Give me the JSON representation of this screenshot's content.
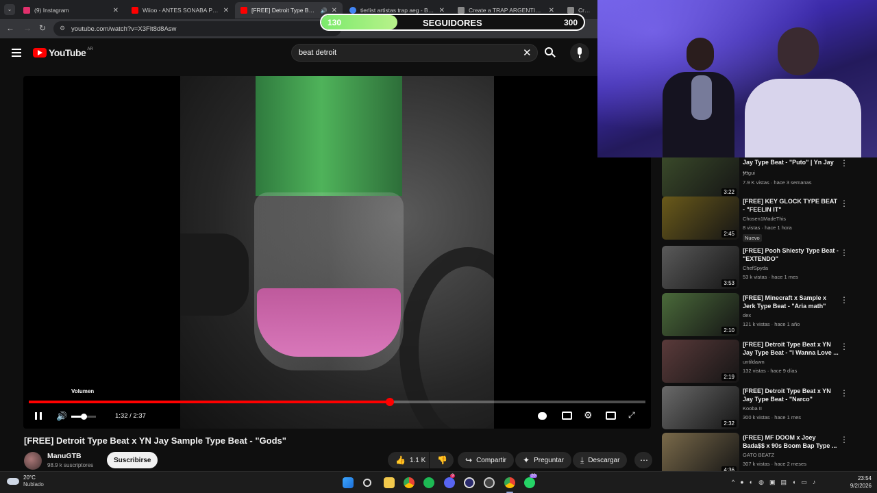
{
  "browser": {
    "tabs": [
      {
        "label": "(9) Instagram",
        "color": "#e1306c"
      },
      {
        "label": "Wiioo - ANTES SONABA PEOR",
        "color": "#ff0000"
      },
      {
        "label": "[FREE] Detroit Type Beat x Y",
        "color": "#ff0000"
      },
      {
        "label": "tierlist artistas trap aeg - Busca",
        "color": "#4285f4"
      },
      {
        "label": "Create a TRAP ARGENTINO Tie",
        "color": "#888888"
      },
      {
        "label": "Create a",
        "color": "#888888"
      }
    ],
    "url": "youtube.com/watch?v=X3Flt8d8Asw"
  },
  "overlay": {
    "min": "130",
    "label": "SEGUIDORES",
    "max": "300",
    "progress": 0.29
  },
  "youtube": {
    "logo": "YouTube",
    "region": "AR",
    "search_value": "beat detroit"
  },
  "player": {
    "tooltip": "Volumen",
    "time": "1:32 / 2:37",
    "progress": 0.586,
    "volume": 0.5
  },
  "video": {
    "title": "[FREE] Detroit Type Beat x YN Jay Sample Type Beat - \"Gods\"",
    "channel": "ManuGTB",
    "subscribers": "98.9 k suscriptores",
    "subscribe_label": "Suscribirse",
    "likes": "1.1 K",
    "share_label": "Compartir",
    "ask_label": "Preguntar",
    "download_label": "Descargar"
  },
  "sidebar": {
    "items": [
      {
        "title": "Jay Type Beat - \"Puto\" | Yn Jay ...",
        "channel": "yugui",
        "meta": "7.9 K vistas · hace 3 semanas",
        "duration": "3:22",
        "badge": ""
      },
      {
        "title": "[FREE] KEY GLOCK TYPE BEAT - \"FEELIN IT\"",
        "channel": "Chosen1MadeThis",
        "meta": "8 vistas · hace 1 hora",
        "duration": "2:45",
        "badge": "Nuevo"
      },
      {
        "title": "[FREE] Pooh Shiesty Type Beat - \"EXTENDO\"",
        "channel": "ChefSpyda",
        "meta": "53 k vistas · hace 1 mes",
        "duration": "3:53",
        "badge": ""
      },
      {
        "title": "[FREE] Minecraft x Sample x Jerk Type Beat - \"Aria math\"",
        "channel": "dex",
        "meta": "121 k vistas · hace 1 año",
        "duration": "2:10",
        "badge": ""
      },
      {
        "title": "[FREE] Detroit Type Beat x YN Jay Type Beat - \"I Wanna Love ...",
        "channel": "untildawn",
        "meta": "132 vistas · hace 9 días",
        "duration": "2:19",
        "badge": ""
      },
      {
        "title": "[FREE] Detroit Type Beat x YN Jay Type Beat - \"Narco\"",
        "channel": "Kooba II",
        "meta": "300 k vistas · hace 1 mes",
        "duration": "2:32",
        "badge": ""
      },
      {
        "title": "(FREE) MF DOOM x Joey Bada$$ x 90s Boom Bap Type ...",
        "channel": "GATO BEATZ",
        "meta": "307 k vistas · hace 2 meses",
        "duration": "4:36",
        "badge": ""
      }
    ]
  },
  "taskbar": {
    "weather_temp": "20°C",
    "weather_desc": "Nublado",
    "time": "23:54",
    "date": "9/2/2026",
    "discord_badge": "9",
    "whatsapp_badge": "20"
  }
}
